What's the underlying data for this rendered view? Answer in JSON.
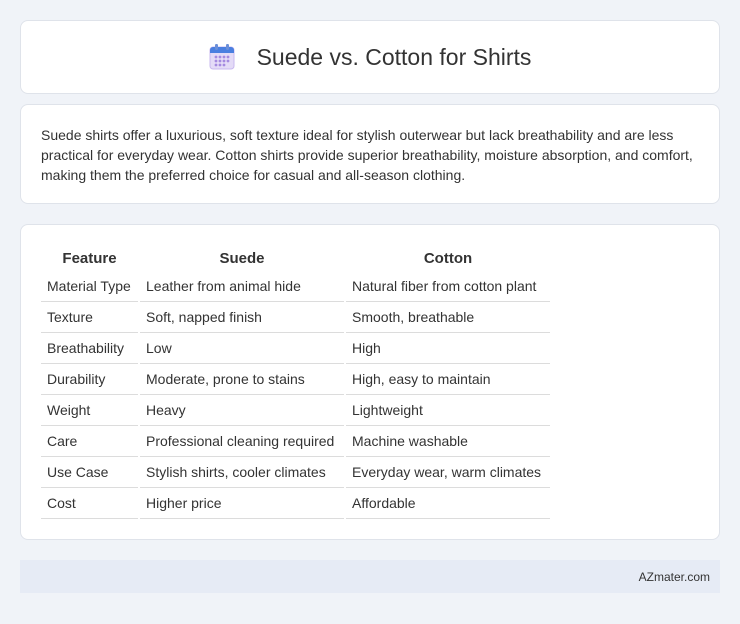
{
  "header": {
    "title": "Suede vs. Cotton for Shirts",
    "icon": "calendar-icon"
  },
  "intro": {
    "text": "Suede shirts offer a luxurious, soft texture ideal for stylish outerwear but lack breathability and are less practical for everyday wear. Cotton shirts provide superior breathability, moisture absorption, and comfort, making them the preferred choice for casual and all-season clothing."
  },
  "table": {
    "headers": [
      "Feature",
      "Suede",
      "Cotton"
    ],
    "rows": [
      [
        "Material Type",
        "Leather from animal hide",
        "Natural fiber from cotton plant"
      ],
      [
        "Texture",
        "Soft, napped finish",
        "Smooth, breathable"
      ],
      [
        "Breathability",
        "Low",
        "High"
      ],
      [
        "Durability",
        "Moderate, prone to stains",
        "High, easy to maintain"
      ],
      [
        "Weight",
        "Heavy",
        "Lightweight"
      ],
      [
        "Care",
        "Professional cleaning required",
        "Machine washable"
      ],
      [
        "Use Case",
        "Stylish shirts, cooler climates",
        "Everyday wear, warm climates"
      ],
      [
        "Cost",
        "Higher price",
        "Affordable"
      ]
    ]
  },
  "footer": {
    "brand": "AZmater.com"
  },
  "colors": {
    "background": "#f0f3f8",
    "card": "#ffffff",
    "footer_bg": "#e6ebf5",
    "icon_top": "#4a7fe0",
    "icon_body": "#dcd0f5"
  }
}
